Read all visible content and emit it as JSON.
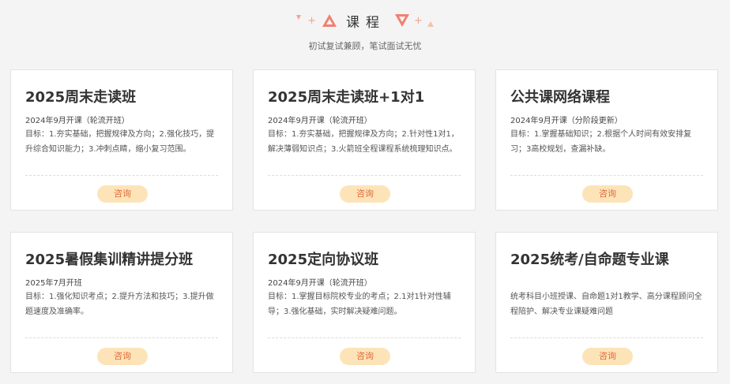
{
  "header": {
    "title": "课程",
    "subtitle": "初试复试兼顾，笔试面试无忧"
  },
  "courses": [
    {
      "title": "2025周末走读班",
      "date": "2024年9月开课（轮流开班）",
      "desc": "目标：1.夯实基础，把握规律及方向；2.强化技巧，提升综合知识能力；3.冲刺点睛，缩小复习范围。",
      "button": "咨询"
    },
    {
      "title": "2025周末走读班+1对1",
      "date": "2024年9月开课（轮流开班）",
      "desc": "目标：1.夯实基础，把握规律及方向；2.针对性1对1，解决薄弱知识点；3.火箭班全程课程系统梳理知识点。",
      "button": "咨询"
    },
    {
      "title": "公共课网络课程",
      "date": "2024年9月开课（分阶段更新）",
      "desc": "目标：1.掌握基础知识；2.根据个人时间有效安排复习；3高校规划，查漏补缺。",
      "button": "咨询"
    },
    {
      "title": "2025暑假集训精讲提分班",
      "date": "2025年7月开班",
      "desc": "目标：1.强化知识考点；2.提升方法和技巧；3.提升做题速度及准确率。",
      "button": "咨询"
    },
    {
      "title": "2025定向协议班",
      "date": "2024年9月开课（轮流开班）",
      "desc": "目标：1.掌握目标院校专业的考点；2.1对1针对性辅导；3.强化基础，实时解决疑难问题。",
      "button": "咨询"
    },
    {
      "title": "2025统考/自命题专业课",
      "date": "",
      "desc": "统考科目小班授课、自命题1对1教学、高分课程顾问全程陪护、解决专业课疑难问题",
      "button": "咨询"
    }
  ],
  "colors": {
    "accent": "#f08070",
    "button_bg": "#fde4b8",
    "button_text": "#e06a3a"
  }
}
